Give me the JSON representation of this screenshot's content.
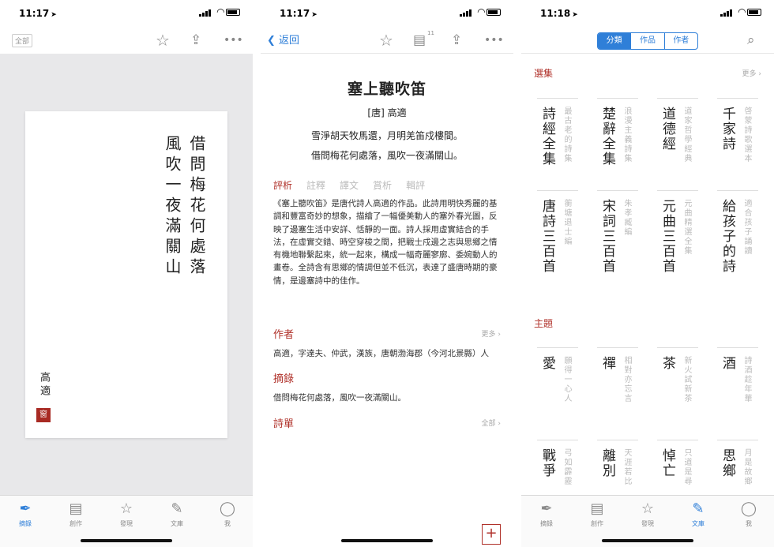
{
  "status": {
    "time1": "11:17",
    "time2": "11:17",
    "time3": "11:18"
  },
  "tabs": [
    "摘錄",
    "創作",
    "發現",
    "文庫",
    "我"
  ],
  "screen1": {
    "all_label": "全部",
    "poem_col1": "借問梅花何處落",
    "poem_col2": "風吹一夜滿關山",
    "author": "高適",
    "seal": "窗"
  },
  "screen2": {
    "back": "返回",
    "list_badge": "11",
    "title": "塞上聽吹笛",
    "author": "[唐] 高適",
    "line1": "雪淨胡天牧馬還，月明羌笛戍樓間。",
    "line2": "借問梅花何處落，風吹一夜滿關山。",
    "subtabs": [
      "評析",
      "註釋",
      "譯文",
      "賞析",
      "輯評"
    ],
    "analysis": "《塞上聽吹笛》是唐代詩人高適的作品。此詩用明快秀麗的基調和豐富奇妙的想象，描繪了一幅優美動人的塞外春光圖，反映了邊塞生活中安詳、恬靜的一面。詩人採用虛實結合的手法，在虛實交錯、時空穿梭之間，把戰士戍邊之志與思鄉之情有機地聯繫起來，統一起來，構成一幅奇麗寥廓、委婉動人的畫卷。全詩含有思鄉的情調但並不低沉，表達了盛唐時期的豪情，是邊塞詩中的佳作。",
    "author_head": "作者",
    "author_more": "更多",
    "author_text": "高適，字達夫、仲武，漢族，唐朝渤海郡（今河北景縣）人",
    "excerpt_head": "摘錄",
    "excerpt_text": "借問梅花何處落，風吹一夜滿關山。",
    "list_head": "詩單",
    "list_more": "全部",
    "plus": "+"
  },
  "screen3": {
    "segments": [
      "分類",
      "作品",
      "作者"
    ],
    "sec1": "選集",
    "sec1_more": "更多",
    "sec2": "主題",
    "books": [
      {
        "title": "詩經全集",
        "desc": "最古老的詩集"
      },
      {
        "title": "楚辭全集",
        "desc": "浪漫主義詩集"
      },
      {
        "title": "道德經",
        "desc": "道家哲學經典"
      },
      {
        "title": "千家詩",
        "desc": "啓蒙詩歌選本"
      },
      {
        "title": "唐詩三百首",
        "desc": "蘅塘退士編"
      },
      {
        "title": "宋詞三百首",
        "desc": "朱孝臧編"
      },
      {
        "title": "元曲三百首",
        "desc": "元曲精選全集"
      },
      {
        "title": "給孩子的詩",
        "desc": "適合孩子誦讀"
      }
    ],
    "themes": [
      {
        "title": "愛",
        "desc": "願得一心人"
      },
      {
        "title": "禪",
        "desc": "相對亦忘言"
      },
      {
        "title": "茶",
        "desc": "新火試新茶"
      },
      {
        "title": "酒",
        "desc": "詩酒趁年華"
      },
      {
        "title": "戰爭",
        "desc": "弓如霹靂"
      },
      {
        "title": "離別",
        "desc": "天涯若比"
      },
      {
        "title": "悼亡",
        "desc": "只道是尋"
      },
      {
        "title": "思鄉",
        "desc": "月是故鄉"
      }
    ]
  },
  "colors": {
    "accent_red": "#b0312a",
    "accent_blue": "#2f7fd8"
  },
  "icons": [
    "location-arrow-icon",
    "signal-icon",
    "wifi-icon",
    "battery-icon",
    "star-icon",
    "share-icon",
    "more-icon",
    "back-chevron-icon",
    "list-icon",
    "search-icon",
    "pen-icon",
    "notebook-icon",
    "discover-star-icon",
    "library-icon",
    "user-icon"
  ]
}
